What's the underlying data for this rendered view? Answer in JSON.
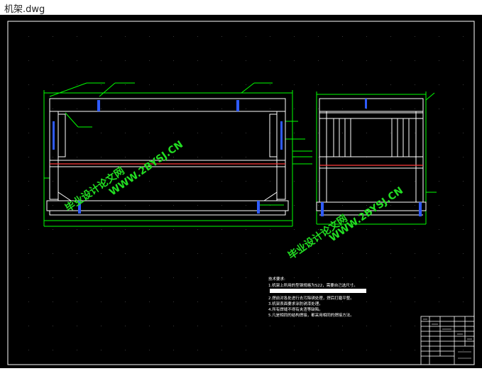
{
  "window": {
    "title": "机架.dwg"
  },
  "drawing": {
    "watermarks": [
      "毕业设计论文网",
      "WWW.2BYSJ.CN",
      "毕业设计论文网",
      "WWW.2BYSJ.CN"
    ],
    "notes_title": "技术要求:",
    "notes": [
      "1.机架上所用的型钢规格为S22，需要自己选尺寸。",
      "2.焊前对各处进行去污除锈处理，焊后打磨平整。",
      "3.机架表面要求涂防锈漆处理。",
      "4.所有焊缝不得有夹渣等缺陷。",
      "5.凡是相同的结构焊接，都采用相同的焊接方法。"
    ],
    "colors": {
      "background": "#000000",
      "lines": "#ffffff",
      "dimensions": "#00ff00",
      "hidden": "#ff3b3b",
      "accent": "#2f5bff"
    }
  }
}
